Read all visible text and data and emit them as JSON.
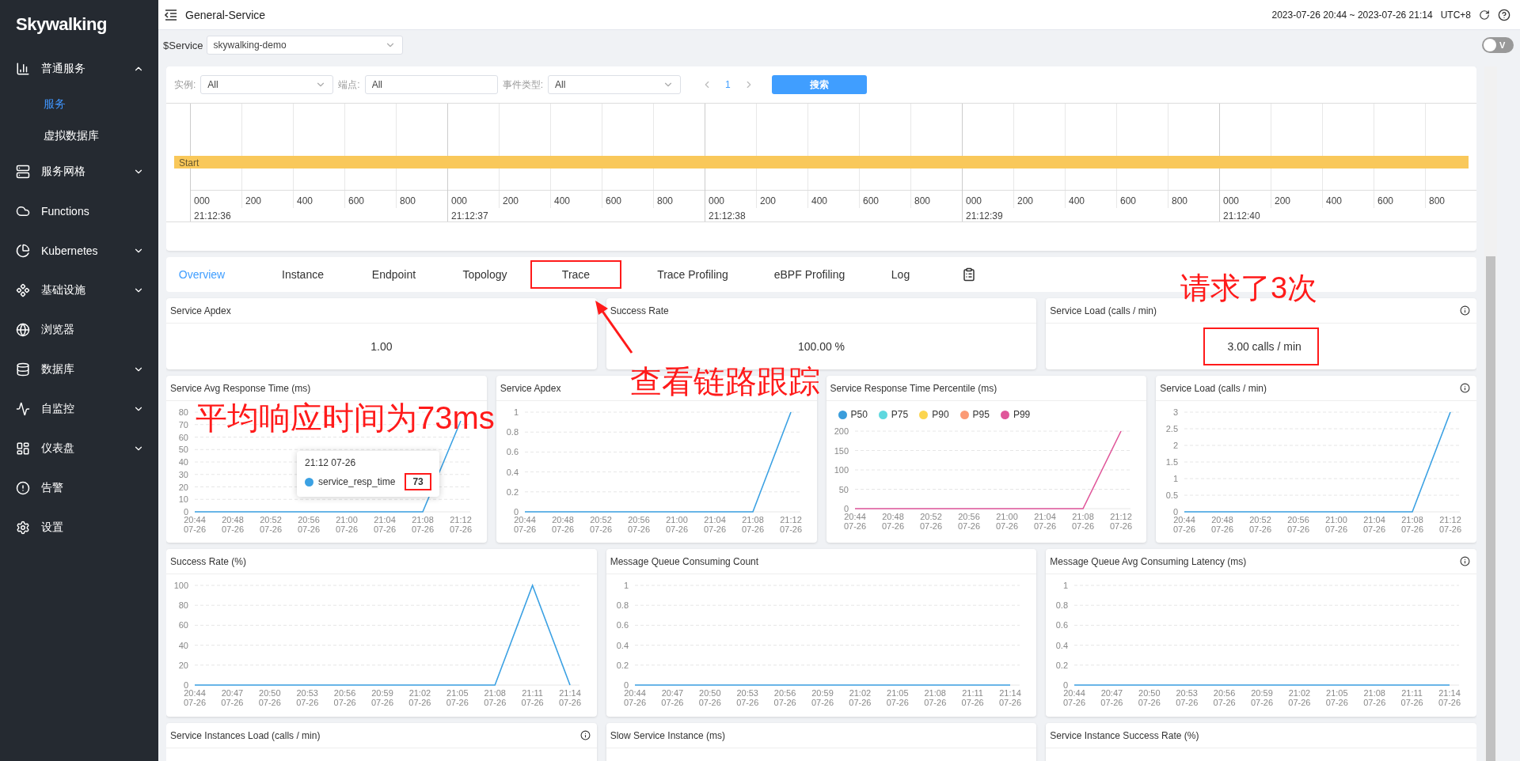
{
  "sidebar": {
    "logo": "Skywalking",
    "items": [
      {
        "label": "普通服务",
        "expanded": true,
        "children": [
          {
            "label": "服务",
            "selected": true
          },
          {
            "label": "虚拟数据库",
            "selected": false
          }
        ]
      },
      {
        "label": "服务网格",
        "expanded": false
      },
      {
        "label": "Functions"
      },
      {
        "label": "Kubernetes",
        "expanded": false
      },
      {
        "label": "基础设施",
        "expanded": false
      },
      {
        "label": "浏览器"
      },
      {
        "label": "数据库",
        "expanded": false
      },
      {
        "label": "自监控",
        "expanded": false
      },
      {
        "label": "仪表盘",
        "expanded": false
      },
      {
        "label": "告警"
      },
      {
        "label": "设置"
      }
    ]
  },
  "header": {
    "title": "General-Service",
    "time_range": "2023-07-26 20:44 ~ 2023-07-26 21:14",
    "timezone": "UTC+8"
  },
  "toolbar": {
    "label": "$Service",
    "select": "skywalking-demo",
    "toggle": {
      "label": "V",
      "on": false
    }
  },
  "trace_panel": {
    "filters": [
      {
        "kind": "select",
        "label": "实例:",
        "value": "All"
      },
      {
        "kind": "input",
        "label": "端点:",
        "value": "All"
      },
      {
        "kind": "select",
        "label": "事件类型:",
        "value": "All"
      }
    ],
    "page": "1",
    "search_button": "搜索",
    "span_label": "Start",
    "segments": [
      {
        "time": "21:12:36",
        "ticks": [
          "000",
          "200",
          "400",
          "600",
          "800"
        ]
      },
      {
        "time": "21:12:37",
        "ticks": [
          "000",
          "200",
          "400",
          "600",
          "800"
        ]
      },
      {
        "time": "21:12:38",
        "ticks": [
          "000",
          "200",
          "400",
          "600",
          "800"
        ]
      },
      {
        "time": "21:12:39",
        "ticks": [
          "000",
          "200",
          "400",
          "600",
          "800"
        ]
      },
      {
        "time": "21:12:40",
        "ticks": [
          "000",
          "200",
          "400",
          "600",
          "800"
        ]
      }
    ]
  },
  "tabs": [
    {
      "label": "Overview",
      "selected": true,
      "highlighted": false
    },
    {
      "label": "Instance",
      "selected": false,
      "highlighted": false
    },
    {
      "label": "Endpoint",
      "selected": false,
      "highlighted": false
    },
    {
      "label": "Topology",
      "selected": false,
      "highlighted": false
    },
    {
      "label": "Trace",
      "selected": false,
      "highlighted": true
    },
    {
      "label": "Trace Profiling",
      "selected": false,
      "highlighted": false
    },
    {
      "label": "eBPF Profiling",
      "selected": false,
      "highlighted": false
    },
    {
      "label": "Log",
      "selected": false,
      "highlighted": false
    }
  ],
  "stats": [
    {
      "title": "Service Apdex",
      "value": "1.00",
      "info": false,
      "highlighted": false
    },
    {
      "title": "Success Rate",
      "value": "100.00",
      "unit": "%",
      "info": false,
      "highlighted": false
    },
    {
      "title": "Service Load (calls / min)",
      "value": "3.00",
      "unit": "calls / min",
      "info": true,
      "highlighted": true
    }
  ],
  "charts_row_1": [
    {
      "title": "Service Avg Response Time (ms)",
      "info": false,
      "tooltip": {
        "title": "21:12 07-26",
        "value": "73",
        "highlighted": true
      },
      "chart_data": {
        "type": "line",
        "grid": true,
        "ylim": [
          0,
          80
        ],
        "yticks": [
          0,
          10,
          20,
          30,
          40,
          50,
          60,
          70,
          80
        ],
        "categories": [
          "20:44\n07-26",
          "20:48\n07-26",
          "20:52\n07-26",
          "20:56\n07-26",
          "21:00\n07-26",
          "21:04\n07-26",
          "21:08\n07-26",
          "21:12\n07-26"
        ],
        "series": [
          {
            "name": "service_resp_time",
            "color": "#3ba1e3",
            "values": [
              0,
              0,
              0,
              0,
              0,
              0,
              0,
              73
            ]
          }
        ]
      }
    },
    {
      "title": "Service Apdex",
      "info": false,
      "chart_data": {
        "type": "line",
        "grid": true,
        "ylim": [
          0,
          1
        ],
        "yticks": [
          0,
          0.2,
          0.4,
          0.6,
          0.8,
          1
        ],
        "categories": [
          "20:44\n07-26",
          "20:48\n07-26",
          "20:52\n07-26",
          "20:56\n07-26",
          "21:00\n07-26",
          "21:04\n07-26",
          "21:08\n07-26",
          "21:12\n07-26"
        ],
        "series": [
          {
            "color": "#3ba1e3",
            "values": [
              0,
              0,
              0,
              0,
              0,
              0,
              0,
              1
            ]
          }
        ]
      }
    },
    {
      "title": "Service Response Time Percentile (ms)",
      "info": false,
      "chart_data": {
        "type": "line",
        "grid": true,
        "ylim": [
          0,
          200
        ],
        "yticks": [
          0,
          50,
          100,
          150,
          200
        ],
        "categories": [
          "20:44\n07-26",
          "20:48\n07-26",
          "20:52\n07-26",
          "20:56\n07-26",
          "21:00\n07-26",
          "21:04\n07-26",
          "21:08\n07-26",
          "21:12\n07-26"
        ],
        "series": [
          {
            "name": "P50",
            "color": "#3a9ddb",
            "values": [
              null,
              null,
              null,
              null,
              null,
              null,
              null,
              null
            ]
          },
          {
            "name": "P75",
            "color": "#5fd8df",
            "values": [
              null,
              null,
              null,
              null,
              null,
              null,
              null,
              null
            ]
          },
          {
            "name": "P90",
            "color": "#fcd54f",
            "values": [
              null,
              null,
              null,
              null,
              null,
              null,
              null,
              null
            ]
          },
          {
            "name": "P95",
            "color": "#fb9a75",
            "values": [
              null,
              null,
              null,
              null,
              null,
              null,
              null,
              null
            ]
          },
          {
            "name": "P99",
            "color": "#e0579a",
            "values": [
              0,
              0,
              0,
              0,
              0,
              0,
              0,
              200
            ]
          }
        ]
      }
    },
    {
      "title": "Service Load (calls / min)",
      "info": true,
      "chart_data": {
        "type": "line",
        "grid": true,
        "ylim": [
          0,
          3
        ],
        "yticks": [
          0,
          0.5,
          1,
          1.5,
          2,
          2.5,
          3
        ],
        "categories": [
          "20:44\n07-26",
          "20:48\n07-26",
          "20:52\n07-26",
          "20:56\n07-26",
          "21:00\n07-26",
          "21:04\n07-26",
          "21:08\n07-26",
          "21:12\n07-26"
        ],
        "series": [
          {
            "color": "#3ba1e3",
            "values": [
              0,
              0,
              0,
              0,
              0,
              0,
              0,
              3
            ]
          }
        ]
      }
    }
  ],
  "charts_row_2": [
    {
      "title": "Success Rate (%)",
      "info": false,
      "chart_data": {
        "type": "line",
        "grid": true,
        "ylim": [
          0,
          100
        ],
        "yticks": [
          0,
          20,
          40,
          60,
          80,
          100
        ],
        "categories": [
          "20:44\n07-26",
          "20:47\n07-26",
          "20:50\n07-26",
          "20:53\n07-26",
          "20:56\n07-26",
          "20:59\n07-26",
          "21:02\n07-26",
          "21:05\n07-26",
          "21:08\n07-26",
          "21:11\n07-26",
          "21:14\n07-26"
        ],
        "series": [
          {
            "color": "#3ba1e3",
            "values": [
              0,
              0,
              0,
              0,
              0,
              0,
              0,
              0,
              0,
              100,
              0
            ]
          }
        ]
      }
    },
    {
      "title": "Message Queue Consuming Count",
      "info": false,
      "chart_data": {
        "type": "line",
        "grid": true,
        "ylim": [
          0,
          1
        ],
        "yticks": [
          0,
          0.2,
          0.4,
          0.6,
          0.8,
          1
        ],
        "categories": [
          "20:44\n07-26",
          "20:47\n07-26",
          "20:50\n07-26",
          "20:53\n07-26",
          "20:56\n07-26",
          "20:59\n07-26",
          "21:02\n07-26",
          "21:05\n07-26",
          "21:08\n07-26",
          "21:11\n07-26",
          "21:14\n07-26"
        ],
        "series": [
          {
            "color": "#3ba1e3",
            "values": [
              0,
              0,
              0,
              0,
              0,
              0,
              0,
              0,
              0,
              0,
              0
            ]
          }
        ]
      }
    },
    {
      "title": "Message Queue Avg Consuming Latency (ms)",
      "info": true,
      "chart_data": {
        "type": "line",
        "grid": true,
        "ylim": [
          0,
          1
        ],
        "yticks": [
          0,
          0.2,
          0.4,
          0.6,
          0.8,
          1
        ],
        "categories": [
          "20:44\n07-26",
          "20:47\n07-26",
          "20:50\n07-26",
          "20:53\n07-26",
          "20:56\n07-26",
          "20:59\n07-26",
          "21:02\n07-26",
          "21:05\n07-26",
          "21:08\n07-26",
          "21:11\n07-26",
          "21:14\n07-26"
        ],
        "series": [
          {
            "color": "#3ba1e3",
            "values": [
              0,
              0,
              0,
              0,
              0,
              0,
              0,
              0,
              0,
              0,
              0
            ]
          }
        ]
      }
    }
  ],
  "bottom_cards": [
    {
      "title": "Service Instances Load (calls / min)",
      "info": true
    },
    {
      "title": "Slow Service Instance (ms)",
      "info": false
    },
    {
      "title": "Service Instance Success Rate (%)",
      "info": false
    }
  ],
  "annotations": [
    {
      "text": "请求了3次"
    },
    {
      "text": "查看链路跟踪"
    },
    {
      "text": "平均响应时间为73ms"
    }
  ]
}
